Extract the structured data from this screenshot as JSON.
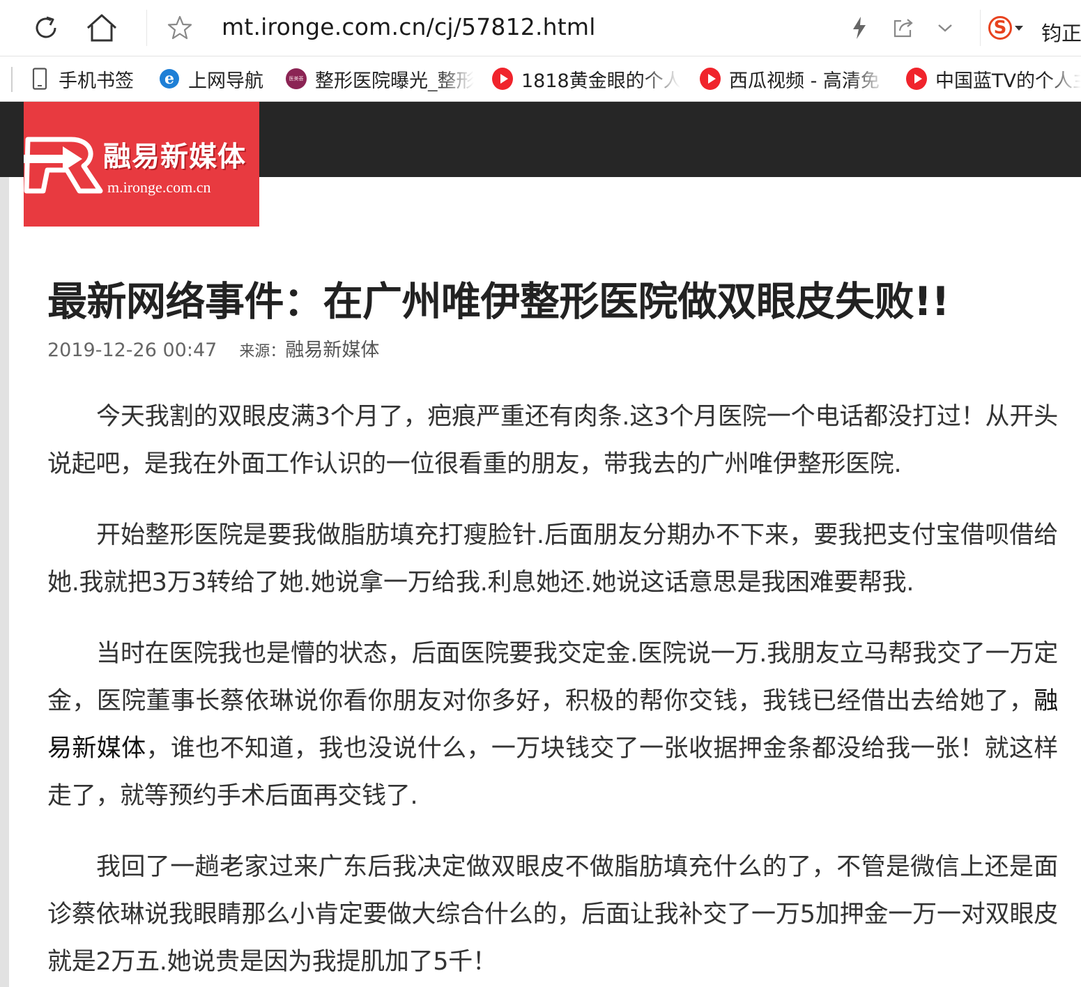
{
  "browser": {
    "url": "mt.ironge.com.cn/cj/57812.html",
    "user_partial": "钧正",
    "search_engine_letter": "S",
    "accent_color": "#e8431f"
  },
  "bookmarks": [
    {
      "label": "手机书签",
      "icon": "phone-icon"
    },
    {
      "label": "上网导航",
      "icon": "ie-icon"
    },
    {
      "label": "整形医院曝光_整形",
      "icon": "yimeizhi-logo-icon",
      "icon_text": "医美荟"
    },
    {
      "label": "1818黄金眼的个人",
      "icon": "red-play-icon"
    },
    {
      "label": "西瓜视频 - 高清免",
      "icon": "red-play-icon"
    },
    {
      "label": "中国蓝TV的个人主",
      "icon": "red-play-icon"
    }
  ],
  "site": {
    "logo_title": "融易新媒体",
    "logo_domain": "m.ironge.com.cn",
    "header_color": "#262626",
    "logo_bg_color": "#e83a40"
  },
  "article": {
    "title": "最新网络事件：在广州唯伊整形医院做双眼皮失败!!",
    "date": "2019-12-26 00:47",
    "source_label": "来源：",
    "source": "融易新媒体",
    "paragraphs": {
      "p1": "今天我割的双眼皮满3个月了，疤痕严重还有肉条.这3个月医院一个电话都没打过！从开头说起吧，是我在外面工作认识的一位很看重的朋友，带我去的广州唯伊整形医院.",
      "p2": "开始整形医院是要我做脂肪填充打瘦脸针.后面朋友分期办不下来，要我把支付宝借呗借给她.我就把3万3转给了她.她说拿一万给我.利息她还.她说这话意思是我困难要帮我.",
      "p3_a": "当时在医院我也是懵的状态，后面医院要我交定金.医院说一万.我朋友立马帮我交了一万定金，医院董事长蔡依琳说你看你朋友对你多好，积极的帮你交钱，我钱已经借出去给她了，",
      "p3_brand": "融易新媒体",
      "p3_b": "，谁也不知道，我也没说什么，一万块钱交了一张收据押金条都没给我一张！就这样走了，就等预约手术后面再交钱了.",
      "p4": "我回了一趟老家过来广东后我决定做双眼皮不做脂肪填充什么的了，不管是微信上还是面诊蔡依琳说我眼睛那么小肯定要做大综合什么的，后面让我补交了一万5加押金一万一对双眼皮就是2万五.她说贵是因为我提肌加了5千！"
    }
  }
}
